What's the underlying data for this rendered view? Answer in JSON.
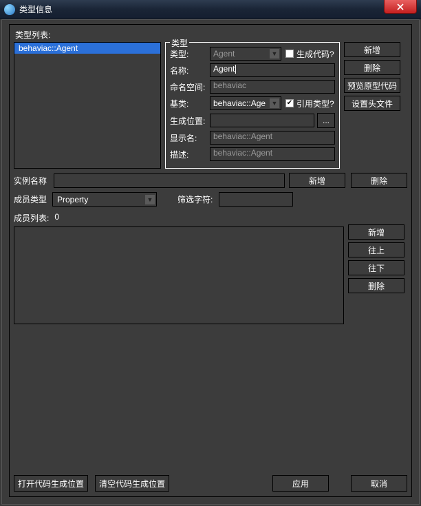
{
  "title": "类型信息",
  "typelist_label": "类型列表:",
  "typelist_items": [
    "behaviac::Agent"
  ],
  "fieldset_legend": "类型",
  "fields": {
    "type_label": "类型:",
    "type_value": "Agent",
    "gen_code_label": "生成代码?",
    "name_label": "名称:",
    "name_value": "Agent",
    "namespace_label": "命名空间:",
    "namespace_value": "behaviac",
    "base_label": "基类:",
    "base_value": "behaviac::Age",
    "ref_type_label": "引用类型?",
    "genloc_label": "生成位置:",
    "genloc_value": "",
    "browse_label": "...",
    "display_label": "显示名:",
    "display_value": "behaviac::Agent",
    "desc_label": "描述:",
    "desc_value": "behaviac::Agent"
  },
  "sidebuttons": {
    "add": "新增",
    "del": "删除",
    "preview": "预览原型代码",
    "setheader": "设置头文件"
  },
  "instance_label": "实例名称",
  "instance_add": "新增",
  "instance_del": "删除",
  "member_type_label": "成员类型",
  "member_type_value": "Property",
  "filter_label": "筛选字符:",
  "member_list_label": "成员列表:",
  "member_list_count": "0",
  "member_buttons": {
    "add": "新增",
    "up": "往上",
    "down": "往下",
    "del": "删除"
  },
  "bottom": {
    "open_genloc": "打开代码生成位置",
    "clear_genloc": "清空代码生成位置",
    "apply": "应用",
    "cancel": "取消"
  }
}
